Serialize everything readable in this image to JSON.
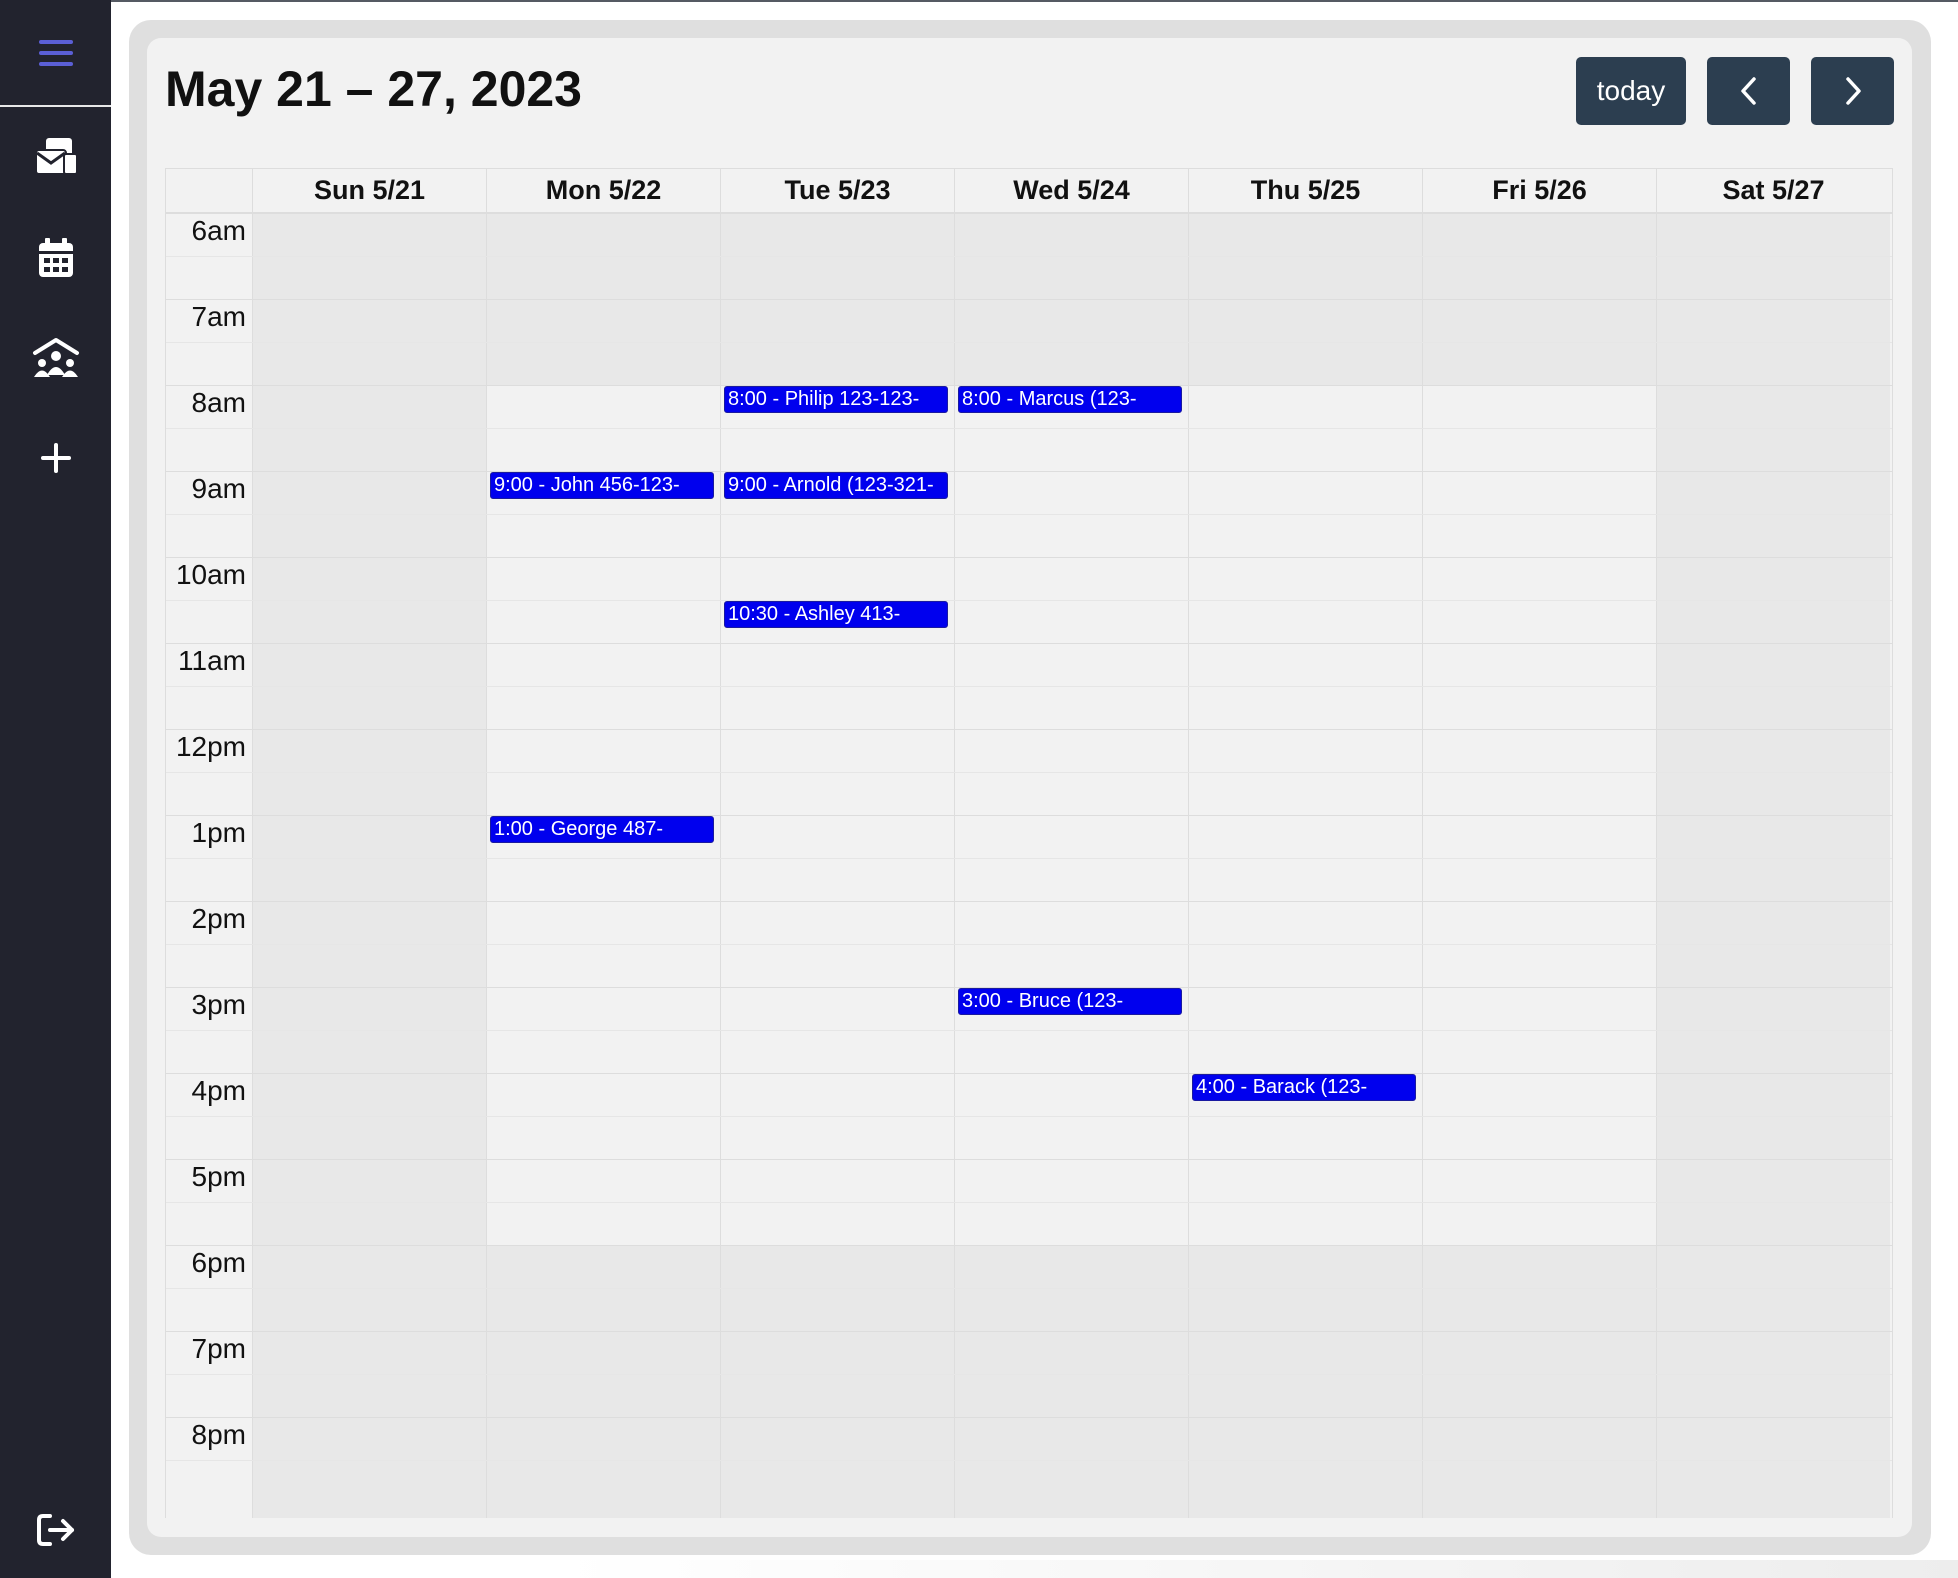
{
  "sidebar": {
    "items": [
      {
        "icon": "menu-icon",
        "color": "#5b5fd6"
      },
      {
        "icon": "mail-stack-icon"
      },
      {
        "icon": "calendar-icon"
      },
      {
        "icon": "people-roof-icon"
      },
      {
        "icon": "plus-icon"
      }
    ],
    "logout_icon": "logout-icon"
  },
  "calendar": {
    "title": "May 21 – 27, 2023",
    "today_label": "today",
    "prev_icon": "chevron-left-icon",
    "next_icon": "chevron-right-icon",
    "days": [
      {
        "label": "Sun 5/21",
        "business": false
      },
      {
        "label": "Mon 5/22",
        "business": true
      },
      {
        "label": "Tue 5/23",
        "business": true
      },
      {
        "label": "Wed 5/24",
        "business": true
      },
      {
        "label": "Thu 5/25",
        "business": true
      },
      {
        "label": "Fri 5/26",
        "business": true
      },
      {
        "label": "Sat 5/27",
        "business": false
      }
    ],
    "hours": [
      "6am",
      "7am",
      "8am",
      "9am",
      "10am",
      "11am",
      "12pm",
      "1pm",
      "2pm",
      "3pm",
      "4pm",
      "5pm",
      "6pm",
      "7pm",
      "8pm"
    ],
    "business_hours": [
      "8am",
      "6pm"
    ],
    "colors": {
      "event": "#0000ee",
      "button": "#2c3e50",
      "business": "#f2f2f2",
      "off_hours": "#e8e8e8",
      "sidebar": "#22232e"
    },
    "events": [
      {
        "day": 1,
        "start": "9:00",
        "text": "9:00 - John 456-123-"
      },
      {
        "day": 1,
        "start": "13:00",
        "text": "1:00 - George 487-"
      },
      {
        "day": 2,
        "start": "8:00",
        "text": "8:00 - Philip 123-123-"
      },
      {
        "day": 2,
        "start": "9:00",
        "text": "9:00 - Arnold (123-321-"
      },
      {
        "day": 2,
        "start": "10:30",
        "text": "10:30 - Ashley 413-"
      },
      {
        "day": 3,
        "start": "8:00",
        "text": "8:00 - Marcus (123-"
      },
      {
        "day": 3,
        "start": "15:00",
        "text": "3:00 - Bruce (123-"
      },
      {
        "day": 4,
        "start": "16:00",
        "text": "4:00 - Barack (123-"
      }
    ]
  }
}
